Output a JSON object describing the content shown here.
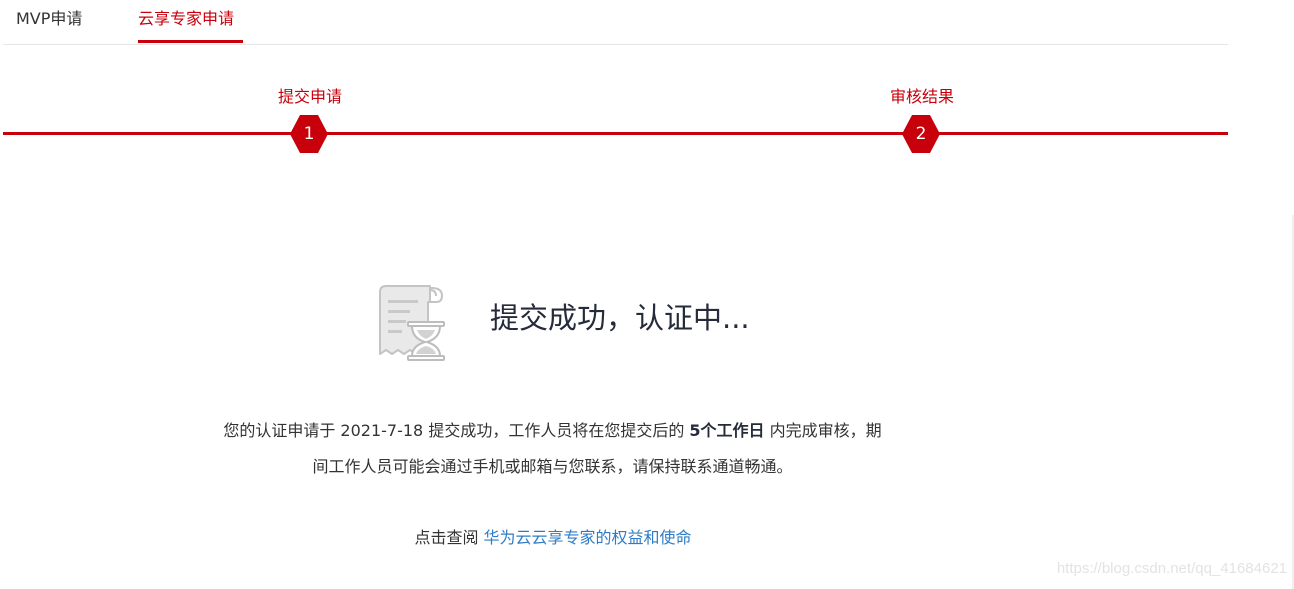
{
  "tabs": [
    {
      "label": "MVP申请",
      "active": false
    },
    {
      "label": "云享专家申请",
      "active": true
    }
  ],
  "steps": [
    {
      "label": "提交申请",
      "number": "1"
    },
    {
      "label": "审核结果",
      "number": "2"
    }
  ],
  "status": {
    "icon": "hourglass-document-icon",
    "title": "提交成功，认证中..."
  },
  "description": {
    "part1": "您的认证申请于 2021-7-18 提交成功，工作人员将在您提交后的 ",
    "highlight": "5个工作日",
    "part2": " 内完成审核，期间工作人员可能会通过手机或邮箱与您联系，请保持联系通道畅通。"
  },
  "link_row": {
    "prefix": "点击查阅 ",
    "link_text": "华为云云享专家的权益和使命"
  },
  "watermark": "https://blog.csdn.net/qq_41684621",
  "colors": {
    "accent": "#c7000b",
    "link": "#2e7cc7",
    "text": "#333333"
  }
}
